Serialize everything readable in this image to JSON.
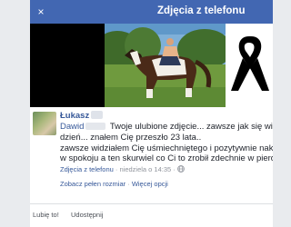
{
  "header": {
    "title": "Zdjęcia z telefonu",
    "close_icon": "×"
  },
  "post": {
    "author": "Łukasz",
    "mention": "Dawid",
    "lines": [
      "Twoje ulubione zdjęcie... zawsze jak się widzieliśmy",
      "dzień... znałem Cię przeszło 23 lata..",
      "zawsze widziałem Cię uśmiechniętego i pozytywnie nakręconego",
      "w spokoju a ten skurwiel co Ci to zrobił zdechnie w pierdlu obiecuje"
    ],
    "meta": {
      "album": "Zdjęcia z telefonu",
      "date": "niedziela o 14:35",
      "separator": "·",
      "audience_icon": "globe-icon"
    },
    "links": {
      "full_size": "Zobacz pełen rozmiar",
      "separator": "·",
      "more": "Więcej opcji"
    }
  },
  "actions": {
    "like": "Lubię to!",
    "share": "Udostępnij"
  },
  "colors": {
    "header": "#4267b2",
    "link": "#365899",
    "meta": "#90949c"
  }
}
